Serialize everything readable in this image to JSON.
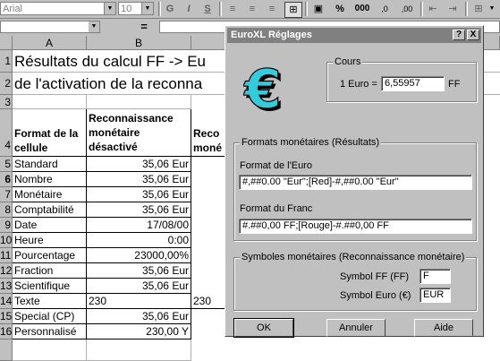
{
  "toolbar": {
    "font_name": "Arial",
    "font_size": "10",
    "bold": "G",
    "italic": "I",
    "underline": "S",
    "percent": "%",
    "thousands": "000",
    "inc_decimal": ",0",
    "dec_decimal": ",00"
  },
  "formula_bar": {
    "equals": "="
  },
  "columns": [
    "A",
    "B"
  ],
  "rows": [
    {
      "num": "1",
      "a": "Résultats du calcul FF -> Eu",
      "b": ""
    },
    {
      "num": "2",
      "a": "de l'activation de la reconna",
      "b": ""
    },
    {
      "num": "3",
      "a": "",
      "b": ""
    },
    {
      "num": "4",
      "a": "Format de la cellule",
      "b": "Reconnaissance monétaire désactivé",
      "c": "Reco moné"
    },
    {
      "num": "5",
      "a": "Standard",
      "b": "35,06 Eur"
    },
    {
      "num": "6",
      "a": "Nombre",
      "b": "35,06 Eur"
    },
    {
      "num": "7",
      "a": "Monétaire",
      "b": "35,06 Eur"
    },
    {
      "num": "8",
      "a": "Comptabilité",
      "b": "35,06 Eur"
    },
    {
      "num": "9",
      "a": "Date",
      "b": "17/08/00"
    },
    {
      "num": "10",
      "a": "Heure",
      "b": "0:00"
    },
    {
      "num": "11",
      "a": "Pourcentage",
      "b": "23000,00%"
    },
    {
      "num": "12",
      "a": "Fraction",
      "b": "35,06 Eur"
    },
    {
      "num": "13",
      "a": "Scientifique",
      "b": "35,06 Eur"
    },
    {
      "num": "14",
      "a": "Texte",
      "b": "230",
      "c": "230"
    },
    {
      "num": "15",
      "a": "Special (CP)",
      "b": "35,06 Eur"
    },
    {
      "num": "16",
      "a": "Personnalisé",
      "b": "230,00 Y"
    }
  ],
  "dialog": {
    "title": "EuroXL Réglages",
    "help_btn": "?",
    "close_btn": "X",
    "cours": {
      "label": "Cours",
      "rate_label": "1 Euro =",
      "rate_value": "6,55957",
      "unit": "FF"
    },
    "formats": {
      "label": "Formats monétaires (Résultats)",
      "euro_label": "Format de l'Euro",
      "euro_value": "#,##0.00 \"Eur\";[Red]-#,##0.00 \"Eur\"",
      "franc_label": "Format du Franc",
      "franc_value": "#.##0,00 FF;[Rouge]-#.##0,00 FF"
    },
    "symbols": {
      "label": "Symboles monétaires (Reconnaissance monétaire)",
      "ff_label": "Symbol FF (FF)",
      "ff_value": "F",
      "euro_label": "Symbol Euro (€)",
      "euro_value": "EUR"
    },
    "buttons": {
      "ok": "OK",
      "cancel": "Annuler",
      "help": "Aide"
    },
    "logo_glyph": "€",
    "logo_color": "#33ccdd"
  }
}
